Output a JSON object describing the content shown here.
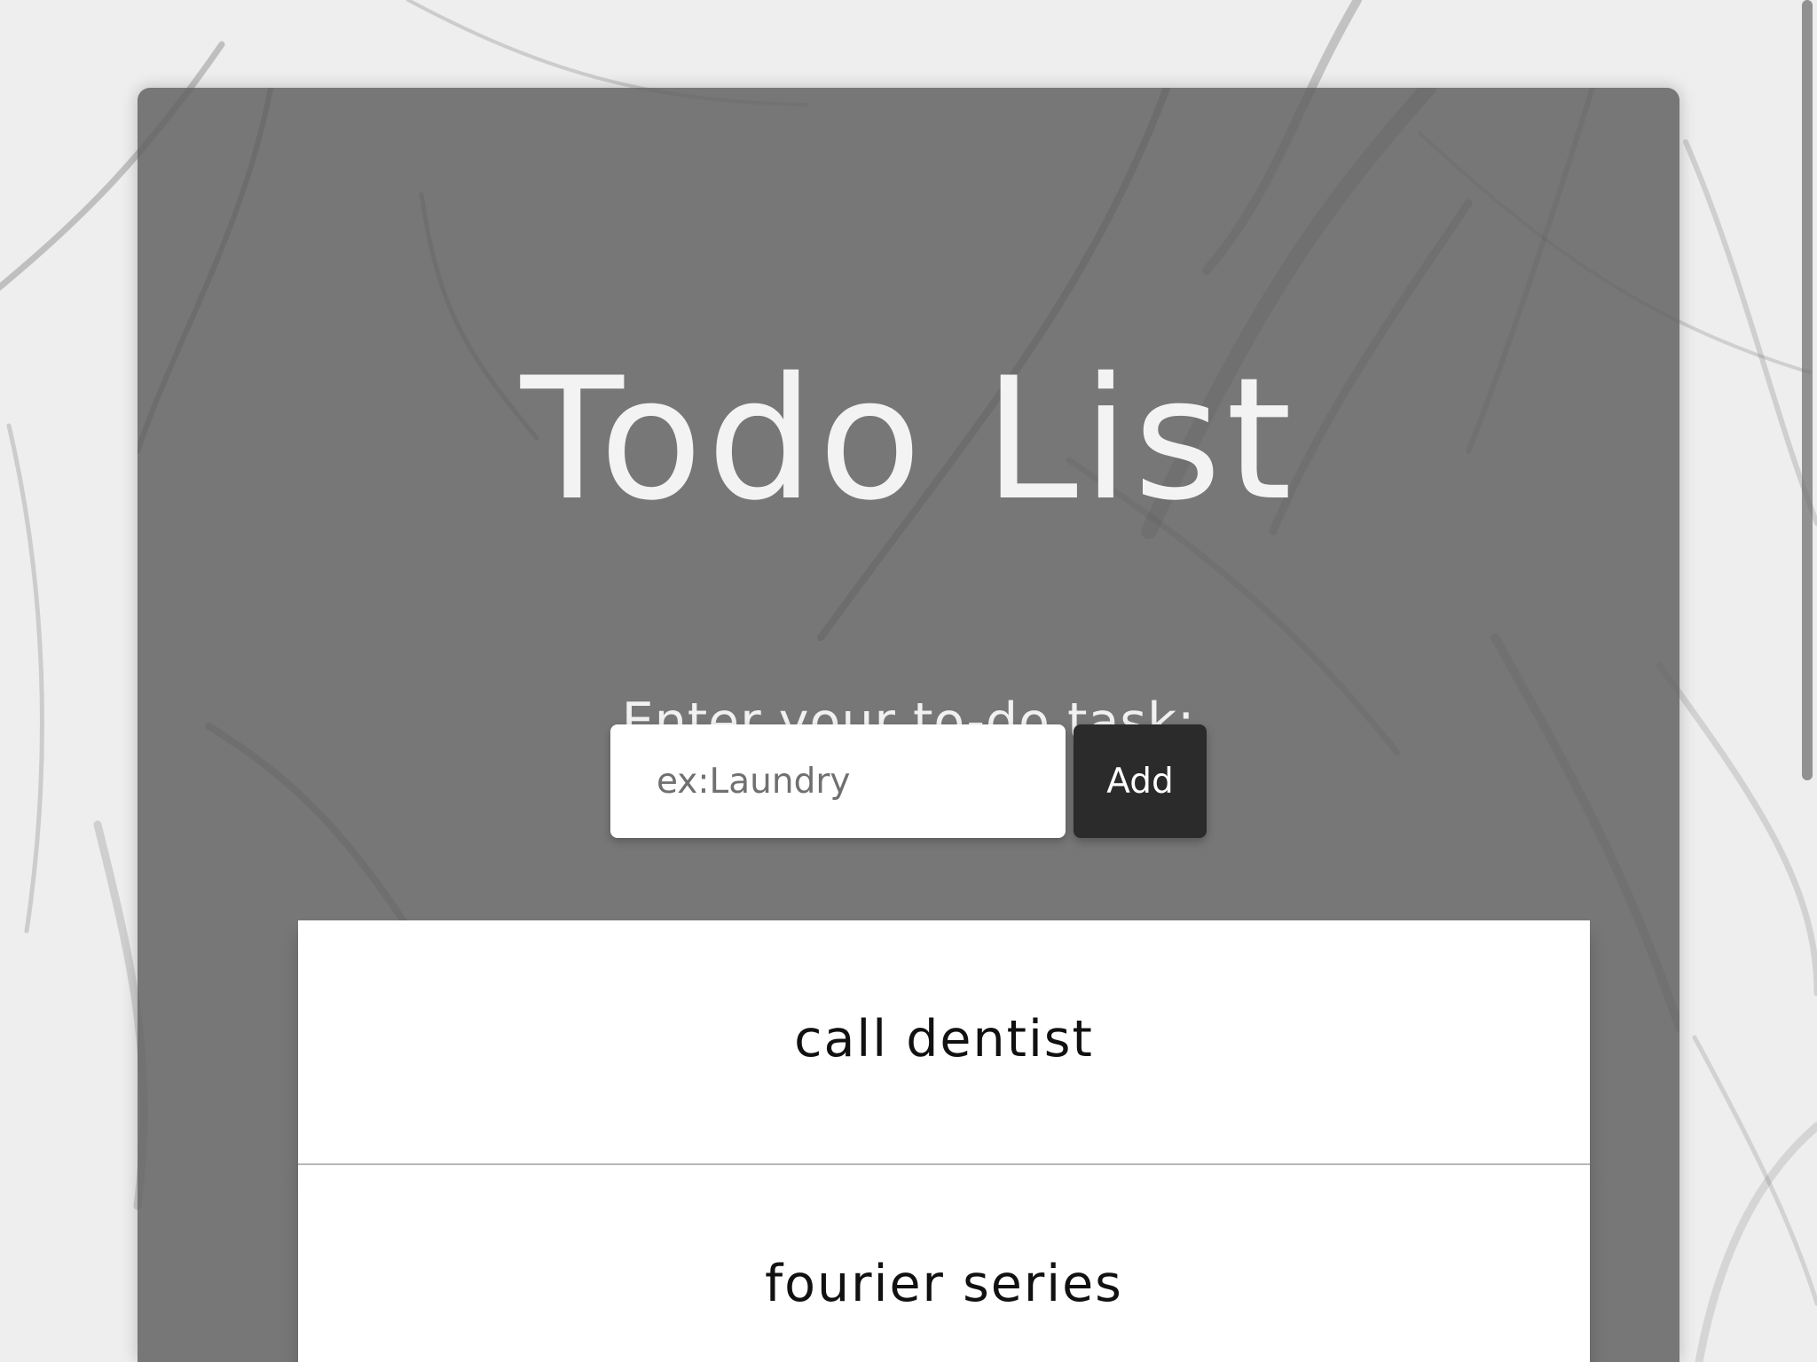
{
  "app": {
    "title": "Todo List"
  },
  "form": {
    "label": "Enter your to-do task:",
    "input_value": "",
    "placeholder": "ex:Laundry",
    "add_label": "Add"
  },
  "todos": [
    {
      "text": "call dentist"
    },
    {
      "text": "fourier series"
    }
  ],
  "icons": {
    "background": "marble-texture-icon"
  },
  "colors": {
    "panel": "#5f5f5f",
    "title": "#f3f3f3",
    "button": "#2b2b2b",
    "list_item": "#ffffff"
  }
}
